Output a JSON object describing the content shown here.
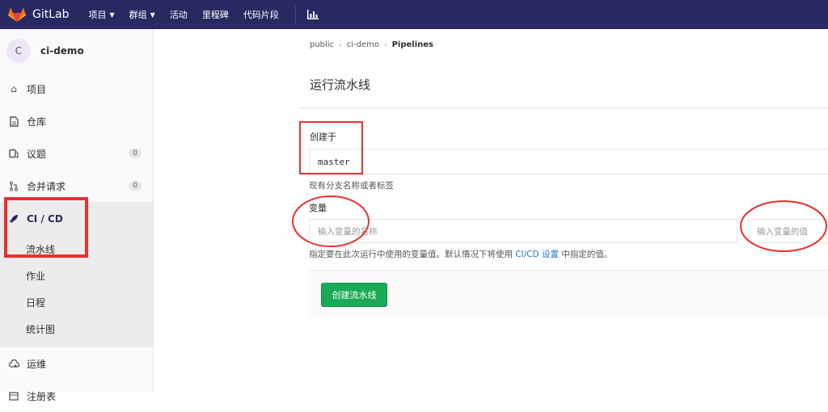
{
  "topbar": {
    "brand": "GitLab",
    "nav": [
      {
        "label": "项目",
        "caret": "⌄"
      },
      {
        "label": "群组",
        "caret": "⌄"
      },
      {
        "label": "活动"
      },
      {
        "label": "里程碑"
      },
      {
        "label": "代码片段"
      }
    ],
    "icons": {
      "logo": "gitlab-fox-icon",
      "chart": "bar-chart-icon"
    },
    "colors": {
      "bg": "#292961"
    }
  },
  "sidebar": {
    "avatar_letter": "C",
    "project_name": "ci-demo",
    "items": [
      {
        "label": "项目",
        "icon": "home-icon"
      },
      {
        "label": "仓库",
        "icon": "document-icon"
      },
      {
        "label": "议题",
        "icon": "issues-icon",
        "badge": "0"
      },
      {
        "label": "合并请求",
        "icon": "merge-request-icon",
        "badge": "0"
      }
    ],
    "cicd": {
      "label": "CI / CD",
      "icon": "rocket-icon",
      "sub": [
        "流水线",
        "作业",
        "日程",
        "统计图"
      ]
    },
    "after": [
      {
        "label": "运维",
        "icon": "cloud-gear-icon"
      },
      {
        "label": "注册表",
        "icon": "package-icon"
      }
    ]
  },
  "breadcrumb": [
    "public",
    "ci-demo",
    "Pipelines"
  ],
  "page_title": "运行流水线",
  "form": {
    "ref_label": "创建于",
    "ref_value": "master",
    "ref_help": "现有分支名称或者标签",
    "var_label": "变量",
    "var_key_placeholder": "输入变量的名称",
    "var_value_placeholder": "输入变量的值",
    "var_help_prefix": "指定要在此次运行中使用的变量值。默认情况下将使用",
    "var_help_link": "CI/CD 设置",
    "var_help_suffix": "中指定的值。",
    "submit_label": "创建流水线"
  },
  "colors": {
    "accent_green": "#1aaa55",
    "link": "#1f78d1",
    "annotation_red": "#e8302f"
  }
}
